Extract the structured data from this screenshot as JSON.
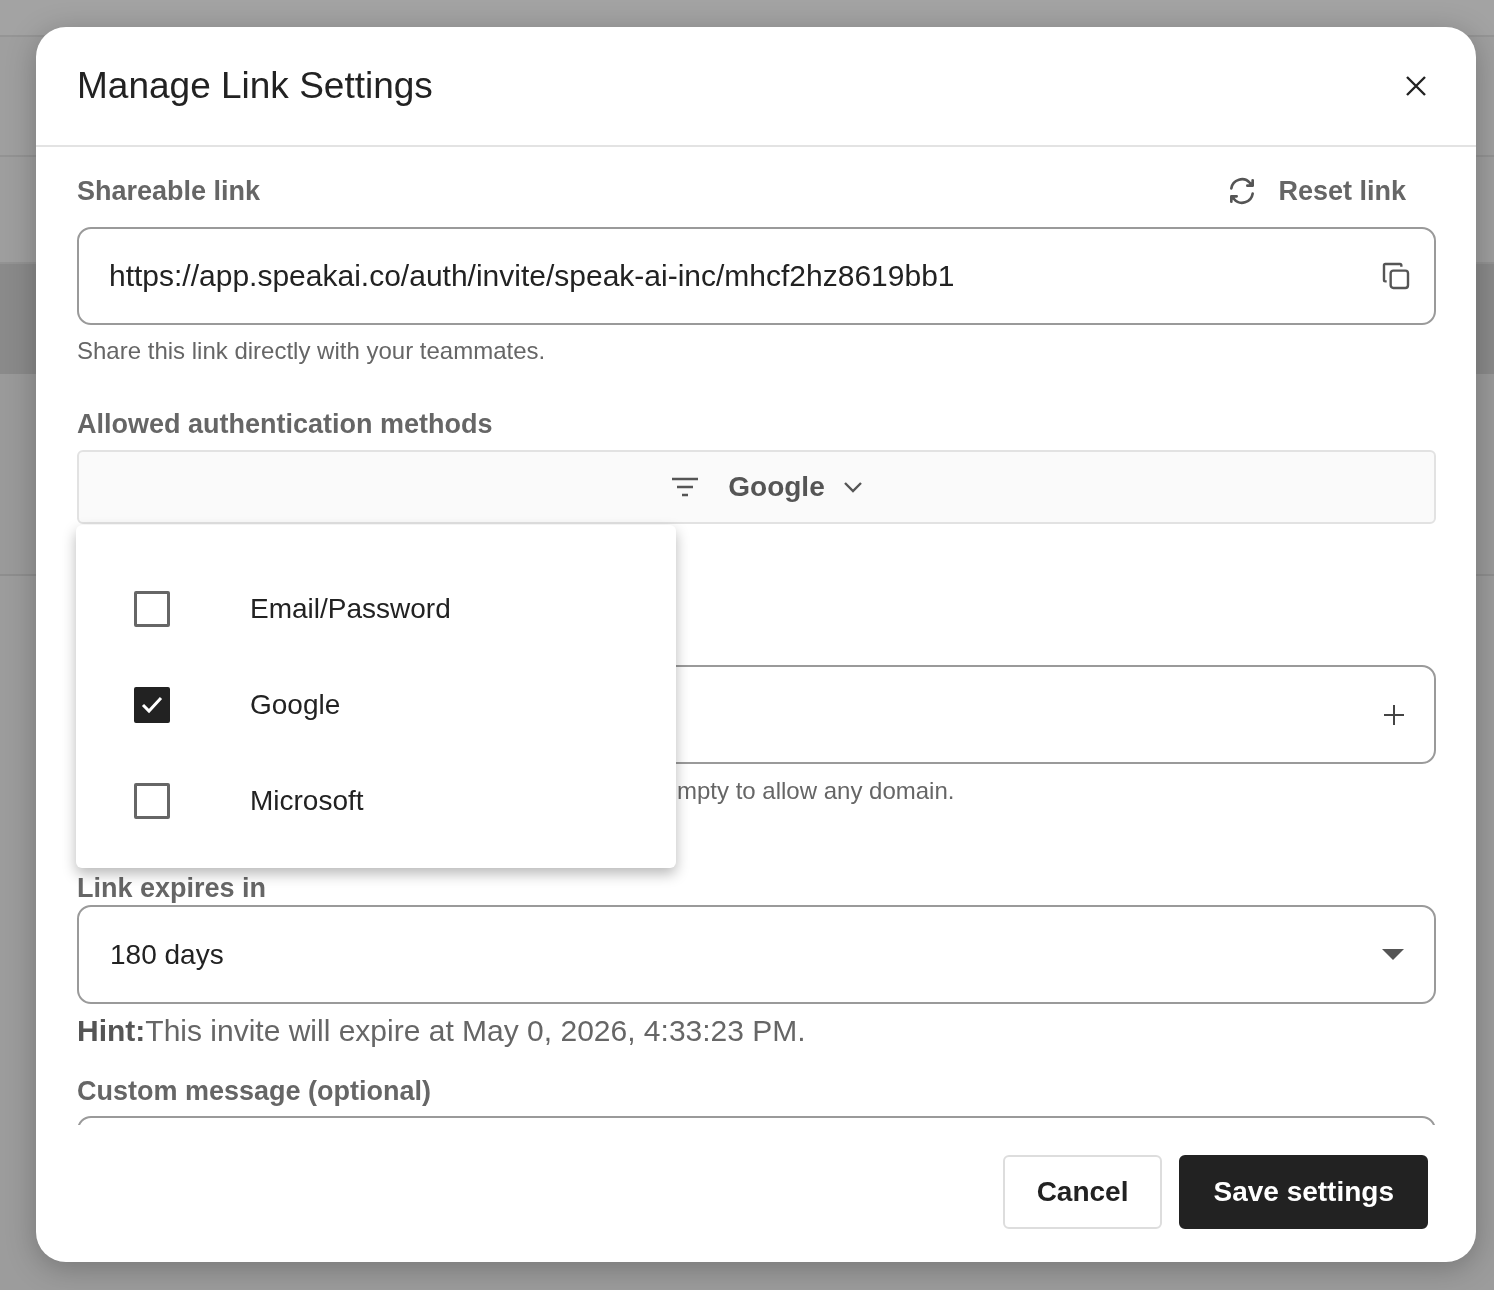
{
  "dialog": {
    "title": "Manage Link Settings",
    "shareable_link": {
      "label": "Shareable link",
      "reset": "Reset link",
      "value": "https://app.speakai.co/auth/invite/speak-ai-inc/mhcf2hz8619bb1",
      "helper": "Share this link directly with your teammates."
    },
    "auth_methods": {
      "label": "Allowed authentication methods",
      "value": "Google",
      "expanded": true,
      "options": [
        {
          "label": "Email/Password",
          "checked": false
        },
        {
          "label": "Google",
          "checked": true
        },
        {
          "label": "Microsoft",
          "checked": false
        }
      ]
    },
    "domains": {
      "helper": "mpty to allow any domain."
    },
    "expiry": {
      "label": "Link expires in",
      "value": "180 days",
      "hint": "**Hint:**This invite will expire at May 0, 2026, 4:33:23 PM."
    },
    "custom_message": {
      "label": "Custom message (optional)"
    },
    "buttons": [
      {
        "label": "Cancel",
        "kind": "secondary"
      },
      {
        "label": "Save settings",
        "kind": "primary"
      }
    ]
  }
}
